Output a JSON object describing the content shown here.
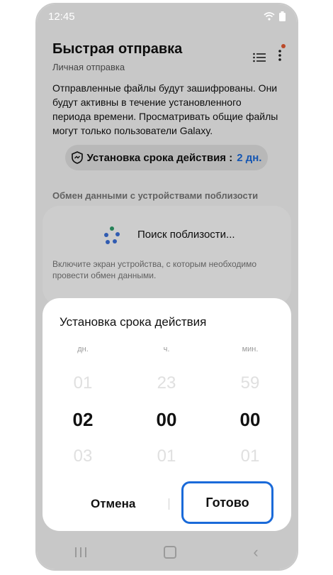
{
  "status_bar": {
    "time": "12:45"
  },
  "header": {
    "title": "Быстрая отправка",
    "subtitle": "Личная отправка"
  },
  "description": "Отправленные файлы будут зашифрованы. Они будут активны в течение установленного периода времени. Просматривать общие файлы могут только пользователи Galaxy.",
  "expiry_pill": {
    "label": "Установка срока действия :",
    "value": "2 дн."
  },
  "nearby": {
    "section_label": "Обмен данными с устройствами поблизости",
    "searching": "Поиск поблизости...",
    "hint": "Включите экран устройства, с которым необходимо провести обмен данными."
  },
  "sheet": {
    "title": "Установка срока действия",
    "columns": [
      {
        "label": "дн.",
        "prev": "01",
        "selected": "02",
        "next": "03"
      },
      {
        "label": "ч.",
        "prev": "23",
        "selected": "00",
        "next": "01"
      },
      {
        "label": "мин.",
        "prev": "59",
        "selected": "00",
        "next": "01"
      }
    ],
    "cancel_label": "Отмена",
    "done_label": "Готово"
  },
  "icons": {
    "menu": "list-icon",
    "more": "more-vertical-icon",
    "shield": "shield-icon",
    "spinner": "loading-dots-icon",
    "nav_recent": "recent-apps-icon",
    "nav_home": "home-icon",
    "nav_back": "back-icon"
  },
  "colors": {
    "accent": "#1a6ad9",
    "badge": "#e35a33"
  }
}
